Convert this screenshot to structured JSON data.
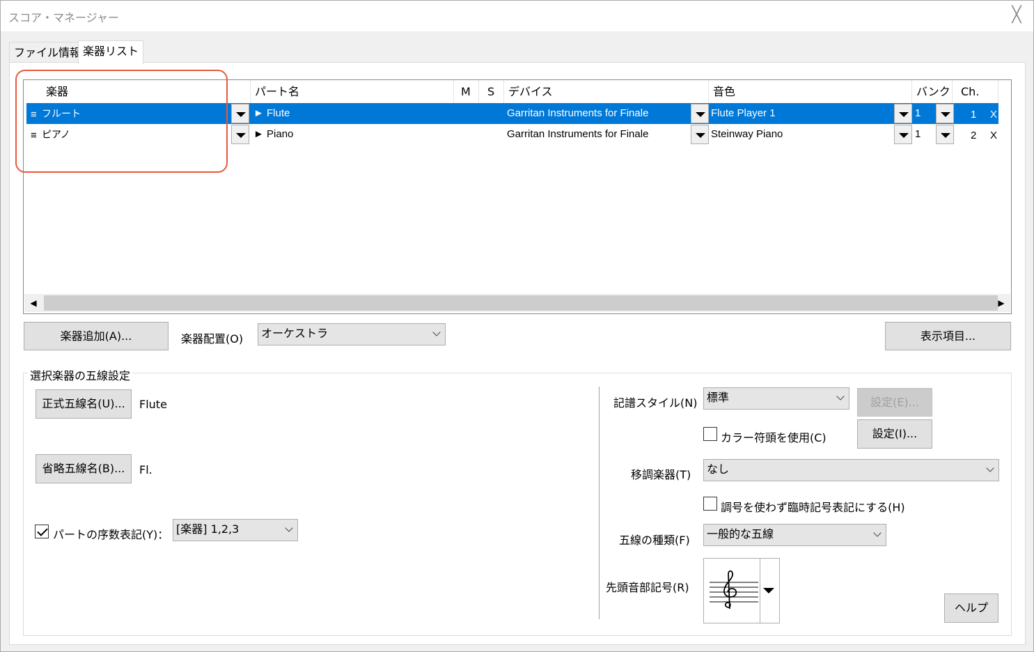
{
  "window": {
    "title": "スコア・マネージャー",
    "close_glyph": "╳"
  },
  "tabs": [
    {
      "label": "ファイル情報",
      "active": false
    },
    {
      "label": "楽器リスト",
      "active": true
    }
  ],
  "table": {
    "columns": [
      "楽器",
      "パート名",
      "M",
      "S",
      "デバイス",
      "音色",
      "バンク",
      "Ch."
    ],
    "rows": [
      {
        "handle": "≡",
        "instrument": "フルート",
        "part": "► Flute",
        "device": "Garritan Instruments for Finale",
        "timbre": "Flute Player 1",
        "bank": "1",
        "ch": "1",
        "x": "X",
        "selected": true
      },
      {
        "handle": "≡",
        "instrument": "ピアノ",
        "part": "► Piano",
        "device": "Garritan Instruments for Finale",
        "timbre": "Steinway Piano",
        "bank": "1",
        "ch": "2",
        "x": "X",
        "selected": false
      }
    ],
    "scroll_left": "◀",
    "scroll_right": "▶"
  },
  "toolbar": {
    "add_instrument": "楽器追加(A)...",
    "arrangement_label": "楽器配置(O)",
    "arrangement_value": "オーケストラ",
    "display_items": "表示項目..."
  },
  "staff_settings": {
    "group_title": "選択楽器の五線設定",
    "full_name_button": "正式五線名(U)...",
    "full_name_value": "Flute",
    "abbr_name_button": "省略五線名(B)...",
    "abbr_name_value": "Fl.",
    "part_numbering_label": "パートの序数表記(Y)：",
    "part_numbering_checked": true,
    "part_numbering_value": "[楽器] 1,2,3",
    "notation_style_label": "記譜スタイル(N)",
    "notation_style_value": "標準",
    "settings_e_button": "設定(E)...",
    "color_noteheads_label": "カラー符頭を使用(C)",
    "color_noteheads_checked": false,
    "settings_i_button": "設定(I)...",
    "transposition_label": "移調楽器(T)",
    "transposition_value": "なし",
    "key_accidentals_label": "調号を使わず臨時記号表記にする(H)",
    "key_accidentals_checked": false,
    "staff_type_label": "五線の種類(F)",
    "staff_type_value": "一般的な五線",
    "first_clef_label": "先頭音部記号(R)",
    "help_button": "ヘルプ"
  },
  "colors": {
    "selection": "#0078d7",
    "annotation": "#e8583c"
  }
}
